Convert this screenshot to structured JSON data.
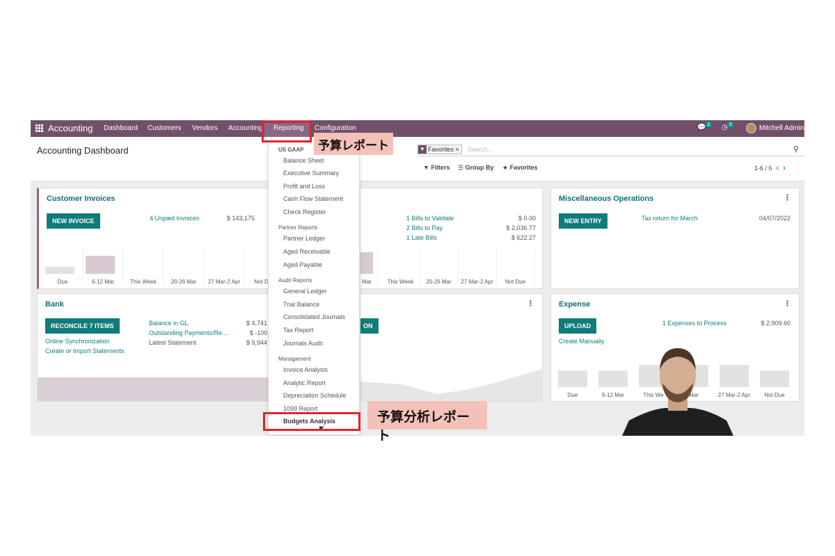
{
  "topbar": {
    "brand": "Accounting",
    "nav": [
      "Dashboard",
      "Customers",
      "Vendors",
      "Accounting",
      "Reporting",
      "Configuration"
    ],
    "chat_count": "2",
    "activity_count": "5",
    "user": "Mitchell Admin"
  },
  "control": {
    "title": "Accounting Dashboard",
    "facet": "Favorites",
    "search_placeholder": "Search...",
    "filters": "Filters",
    "group_by": "Group By",
    "favorites": "Favorites",
    "pager": "1-6 / 6"
  },
  "customer_invoices": {
    "title": "Customer Invoices",
    "button": "NEW INVOICE",
    "link": "4 Unpaid Invoices",
    "amount": "$ 143,175",
    "bar_labels": [
      "Due",
      "6-12 Mar",
      "This Week",
      "20-26 Mar",
      "27 Mar-2 Apr",
      "Not Due"
    ],
    "bar_values": [
      0.25,
      0.65,
      0,
      0,
      0,
      0
    ]
  },
  "vendor_bills": {
    "rows": [
      {
        "label": "1 Bills to Validate",
        "amount": "$ 0.00"
      },
      {
        "label": "2 Bills to Pay",
        "amount": "$ 2,036.77"
      },
      {
        "label": "1 Late Bills",
        "amount": "$ 622.27"
      }
    ],
    "bar_labels": [
      "Mar",
      "This Week",
      "20-26 Mar",
      "27 Mar-2 Apr",
      "Not Due"
    ]
  },
  "misc": {
    "title": "Miscellaneous Operations",
    "button": "NEW ENTRY",
    "link": "Tax return for March",
    "date": "04/07/2022"
  },
  "bank": {
    "title": "Bank",
    "button": "RECONCILE 7 ITEMS",
    "links": [
      "Online Synchronization",
      "Create or Import Statements"
    ],
    "rows": [
      {
        "label": "Balance in GL",
        "amount": "$ 4,741"
      },
      {
        "label": "Outstanding Payments/Re...",
        "amount": "$ -100"
      },
      {
        "label": "Latest Statement",
        "amount": "$ 9,944"
      }
    ]
  },
  "cash": {
    "button_tail": "ON"
  },
  "expense": {
    "title": "Expense",
    "button": "UPLOAD",
    "link2": "Create Manually",
    "link": "1 Expenses to Process",
    "amount": "$ 2,909.60",
    "bar_labels": [
      "Due",
      "6-12 Mar",
      "This We",
      "Mar",
      "27 Mar-2 Apr",
      "Not Due"
    ]
  },
  "dropdown": {
    "us_gaap": "US GAAP",
    "items_a": [
      "Balance Sheet",
      "Executive Summary",
      "Profit and Loss",
      "Cash Flow Statement",
      "Check Register"
    ],
    "partner": "Partner Reports",
    "items_b": [
      "Partner Ledger",
      "Aged Receivable",
      "Aged Payable"
    ],
    "audit": "Audit Reports",
    "items_c": [
      "General Ledger",
      "Trial Balance",
      "Consolidated Journals",
      "Tax Report",
      "Journals Audit"
    ],
    "management": "Management",
    "items_d": [
      "Invoice Analysis",
      "Analytic Report",
      "Depreciation Schedule",
      "1099 Report",
      "Budgets Analysis"
    ]
  },
  "annotations": {
    "reporting_label": "予算レポート",
    "budget_label": "予算分析レポート"
  },
  "colors": {
    "topbar": "#71506b",
    "teal": "#0f7c7a",
    "highlight_red": "#e0242f",
    "label_bg": "#f4c1b9"
  }
}
